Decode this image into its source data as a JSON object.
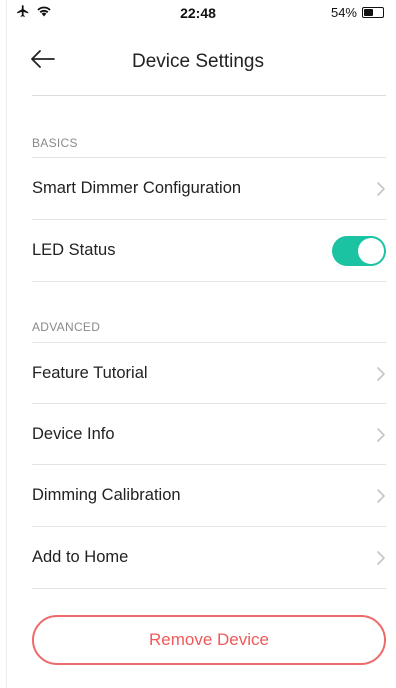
{
  "status_bar": {
    "time": "22:48",
    "battery_percent": "54%",
    "battery_level": 0.54,
    "icons": [
      "airplane-icon",
      "wifi-icon",
      "battery-icon"
    ]
  },
  "header": {
    "title": "Device Settings",
    "back_icon": "back-arrow-icon"
  },
  "sections": {
    "basics": {
      "label": "BASICS",
      "items": [
        {
          "label": "Smart Dimmer Configuration",
          "control": "chevron"
        },
        {
          "label": "LED Status",
          "control": "toggle",
          "on": true
        }
      ]
    },
    "advanced": {
      "label": "ADVANCED",
      "items": [
        {
          "label": "Feature Tutorial",
          "control": "chevron"
        },
        {
          "label": "Device Info",
          "control": "chevron"
        },
        {
          "label": "Dimming Calibration",
          "control": "chevron"
        },
        {
          "label": "Add to Home",
          "control": "chevron"
        }
      ]
    }
  },
  "remove_button": {
    "label": "Remove Device"
  },
  "colors": {
    "accent": "#1bc3a3",
    "danger": "#ee5a5a",
    "divider": "#e3e3e3",
    "section_label": "#8a8a8a"
  }
}
